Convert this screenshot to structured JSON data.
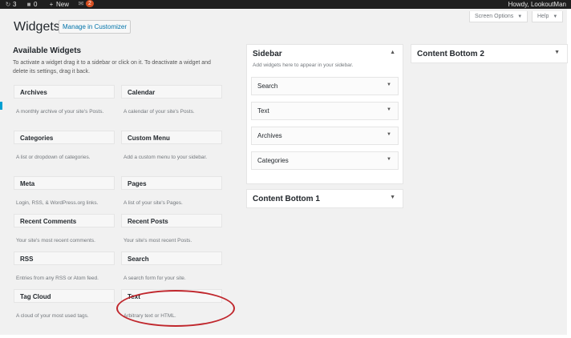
{
  "adminbar": {
    "updates_count": "3",
    "comments_count": "0",
    "new_label": "New",
    "badge_count": "2",
    "greeting": "Howdy, LookoutMan"
  },
  "header": {
    "title": "Widgets",
    "manage_label": "Manage in Customizer",
    "screen_options": "Screen Options",
    "help": "Help"
  },
  "available": {
    "title": "Available Widgets",
    "description": "To activate a widget drag it to a sidebar or click on it. To deactivate a widget and delete its settings, drag it back.",
    "widgets": [
      {
        "name": "Archives",
        "desc": "A monthly archive of your site's Posts."
      },
      {
        "name": "Calendar",
        "desc": "A calendar of your site's Posts."
      },
      {
        "name": "Categories",
        "desc": "A list or dropdown of categories."
      },
      {
        "name": "Custom Menu",
        "desc": "Add a custom menu to your sidebar."
      },
      {
        "name": "Meta",
        "desc": "Login, RSS, & WordPress.org links."
      },
      {
        "name": "Pages",
        "desc": "A list of your site's Pages."
      },
      {
        "name": "Recent Comments",
        "desc": "Your site's most recent comments."
      },
      {
        "name": "Recent Posts",
        "desc": "Your site's most recent Posts."
      },
      {
        "name": "RSS",
        "desc": "Entries from any RSS or Atom feed."
      },
      {
        "name": "Search",
        "desc": "A search form for your site."
      },
      {
        "name": "Tag Cloud",
        "desc": "A cloud of your most used tags."
      },
      {
        "name": "Text",
        "desc": "Arbitrary text or HTML."
      }
    ]
  },
  "sidebar": {
    "title": "Sidebar",
    "description": "Add widgets here to appear in your sidebar.",
    "widgets": [
      "Search",
      "Text",
      "Archives",
      "Categories"
    ]
  },
  "content_bottom_1": {
    "title": "Content Bottom 1"
  },
  "content_bottom_2": {
    "title": "Content Bottom 2"
  },
  "colors": {
    "accent": "#0073aa",
    "highlight": "#c0272d",
    "adminbar": "#1f1f1f"
  }
}
